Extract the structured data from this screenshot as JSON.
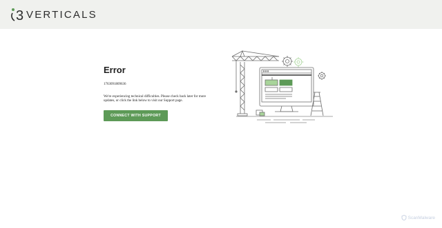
{
  "header": {
    "logo_text": "VERTICALS",
    "logo_mark": "3"
  },
  "error": {
    "title": "Error",
    "code": "1763091809636",
    "message": "We're experiencing technical difficulties. Please check back later for more updates, or click the link below to visit our Support page.",
    "button_label": "CONNECT WITH SUPPORT"
  },
  "watermark": {
    "text": "ScanMalware"
  },
  "colors": {
    "header_bg": "#f0f1ee",
    "accent_green": "#5d9a57",
    "light_green": "#a8d49a",
    "line_gray": "#8a8a8a"
  },
  "icons": {
    "illustration": "construction-crane-monitor-illustration",
    "watermark": "shield-icon"
  }
}
